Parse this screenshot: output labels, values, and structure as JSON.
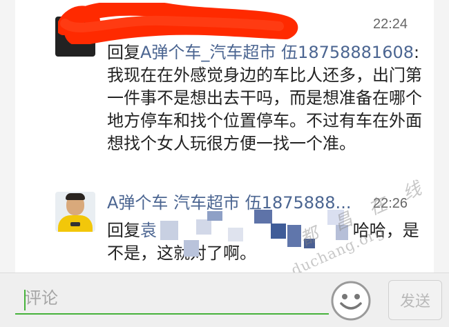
{
  "comments": [
    {
      "time": "22:24",
      "reply_prefix": "回复",
      "reply_target": "A弹个车_汽车超市  伍18758881608",
      "text": ": 我现在在外感觉身边的车比人还多，出门第一件事不是想出去干吗，而是想准备在哪个地方停车和找个位置停车。不过有车在外面想找个女人玩很方便一找一个准。"
    },
    {
      "author": "A弹个车  汽车超市  伍1875888...",
      "time": "22:26",
      "reply_prefix": "回复",
      "reply_target": "袁",
      "text": ": 哈哈，是不是，这就对了啊。"
    }
  ],
  "watermark": {
    "cn": "都 昌 在 线",
    "en": "duchang.org"
  },
  "input": {
    "placeholder": "评论"
  },
  "buttons": {
    "send_label": "发送",
    "emoji_icon": "smiley-face-icon"
  },
  "colors": {
    "name_link": "#4b6591",
    "input_underline": "#45b23a",
    "redaction": "#ff2a00"
  }
}
